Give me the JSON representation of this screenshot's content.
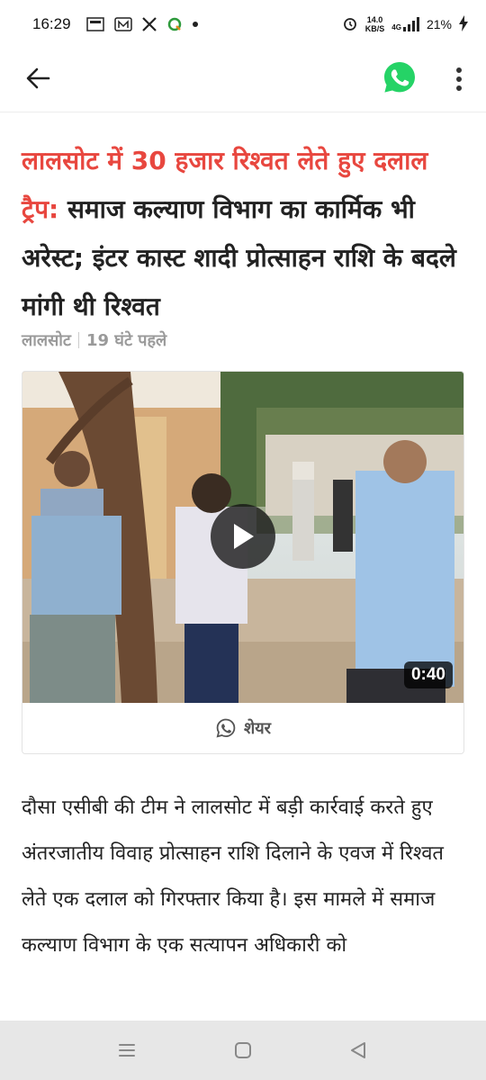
{
  "status_bar": {
    "time": "16:29",
    "notification_icons": [
      "dainik-bhaskar-icon",
      "m-app-icon",
      "x-icon",
      "q-app-icon",
      "dot-icon"
    ],
    "net_speed_value": "14.0",
    "net_speed_unit": "KB/S",
    "network": "4G",
    "battery": "21%"
  },
  "app_bar": {
    "back_icon": "arrow-left-icon",
    "whatsapp_icon": "whatsapp-icon",
    "more_icon": "more-vertical-icon",
    "whatsapp_color": "#25d366"
  },
  "article": {
    "headline_highlight": "लालसोट में 30 हजार रिश्वत लेते हुए दलाल ट्रैप:",
    "headline_rest": " समाज कल्याण विभाग का कार्मिक भी अरेस्ट; इंटर कास्ट शादी प्रोत्साहन राशि के बदले मांगी थी रिश्वत",
    "highlight_color": "#e8473f",
    "location": "लालसोट",
    "time_ago": "19 घंटे पहले",
    "video": {
      "duration": "0:40",
      "play_icon": "play-icon"
    },
    "share_label": "शेयर",
    "body": "दौसा एसीबी की टीम ने लालसोट में बड़ी कार्रवाई करते हुए अंतरजातीय विवाह प्रोत्साहन राशि दिलाने के एवज में रिश्वत लेते एक दलाल को गिरफ्तार किया है। इस मामले में समाज कल्याण विभाग के एक सत्यापन अधिकारी को"
  },
  "nav_bar": {
    "recents_icon": "recents-icon",
    "home_icon": "home-icon",
    "back_icon": "nav-back-icon"
  }
}
